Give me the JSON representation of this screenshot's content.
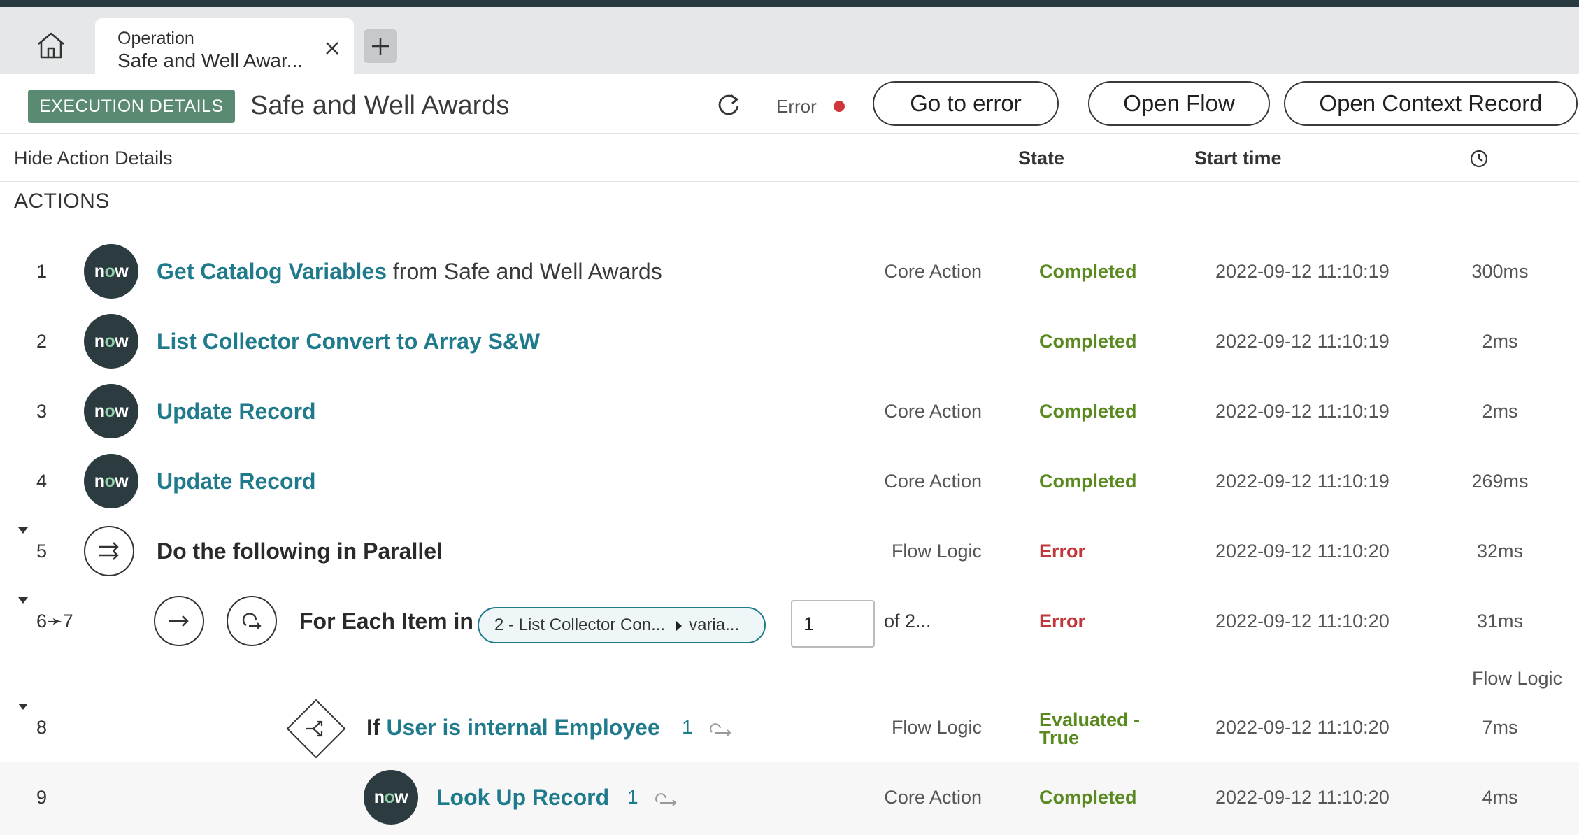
{
  "tabbar": {
    "tab": {
      "line1": "Operation",
      "line2": "Safe and Well Awar..."
    }
  },
  "header": {
    "badge": "EXECUTION DETAILS",
    "title": "Safe and Well Awards",
    "status_label": "Error",
    "buttons": {
      "go_to_error": "Go to error",
      "open_flow": "Open Flow",
      "open_context": "Open Context Record"
    }
  },
  "columns": {
    "hide_details": "Hide Action Details",
    "state": "State",
    "start_time": "Start time"
  },
  "actions_heading": "ACTIONS",
  "icons": {
    "now_prefix": "n",
    "now_o": "o",
    "now_suffix": "w"
  },
  "rows": [
    {
      "num": "1",
      "link": "Get Catalog Variables",
      "suffix": " from Safe and Well Awards",
      "type": "Core Action",
      "state": "Completed",
      "start": "2022-09-12 11:10:19",
      "duration": "300ms"
    },
    {
      "num": "2",
      "link": "List Collector Convert to Array S&W",
      "type": "",
      "state": "Completed",
      "start": "2022-09-12 11:10:19",
      "duration": "2ms"
    },
    {
      "num": "3",
      "link": "Update Record",
      "type": "Core Action",
      "state": "Completed",
      "start": "2022-09-12 11:10:19",
      "duration": "2ms"
    },
    {
      "num": "4",
      "link": "Update Record",
      "type": "Core Action",
      "state": "Completed",
      "start": "2022-09-12 11:10:19",
      "duration": "269ms"
    },
    {
      "num": "5",
      "title": "Do the following in Parallel",
      "type": "Flow Logic",
      "state": "Error",
      "start": "2022-09-12 11:10:20",
      "duration": "32ms"
    },
    {
      "num": "6➛7",
      "title": "For Each Item in",
      "chip_left": "2 - List Collector Con...",
      "chip_right": "varia...",
      "iteration_value": "1",
      "of_label": "of 2...",
      "type": "Flow Logic",
      "state": "Error",
      "start": "2022-09-12 11:10:20",
      "duration": "31ms"
    },
    {
      "num": "8",
      "prefix": "If ",
      "link": "User is internal Employee",
      "count": "1",
      "type": "Flow Logic",
      "state_line1": "Evaluated -",
      "state_line2": "True",
      "start": "2022-09-12 11:10:20",
      "duration": "7ms"
    },
    {
      "num": "9",
      "link": "Look Up Record",
      "count": "1",
      "type": "Core Action",
      "state": "Completed",
      "start": "2022-09-12 11:10:20",
      "duration": "4ms"
    }
  ],
  "colors": {
    "accent": "#1f7a8c",
    "completed": "#5a8a1f",
    "error": "#c0363a",
    "badge": "#5b8a72",
    "dark": "#2b3b3f"
  }
}
